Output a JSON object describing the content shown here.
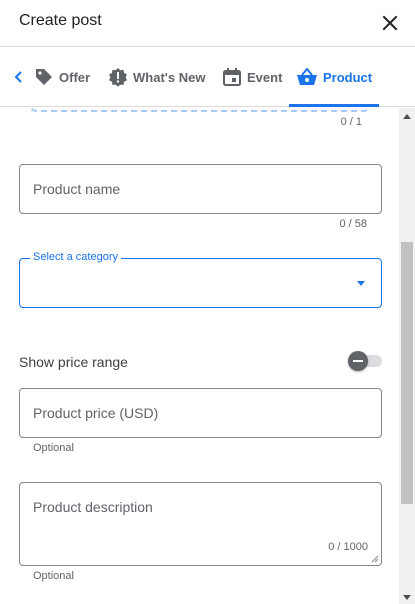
{
  "header": {
    "title": "Create post"
  },
  "tabs": [
    {
      "label": "Offer",
      "icon": "tag-icon"
    },
    {
      "label": "What's New",
      "icon": "alert-badge-icon"
    },
    {
      "label": "Event",
      "icon": "calendar-icon"
    },
    {
      "label": "Product",
      "icon": "basket-icon",
      "active": true
    }
  ],
  "form": {
    "image_counter": "0 / 1",
    "product_name": {
      "placeholder": "Product name",
      "counter": "0 / 58"
    },
    "category": {
      "label": "Select a category",
      "value": ""
    },
    "price_range": {
      "label": "Show price range",
      "enabled": false
    },
    "price": {
      "placeholder": "Product price (USD)",
      "helper": "Optional"
    },
    "description": {
      "placeholder": "Product description",
      "counter": "0 / 1000",
      "helper": "Optional"
    }
  },
  "colors": {
    "accent": "#1a73e8",
    "text": "#3c4043",
    "muted": "#5f6368",
    "border": "#80868b"
  }
}
